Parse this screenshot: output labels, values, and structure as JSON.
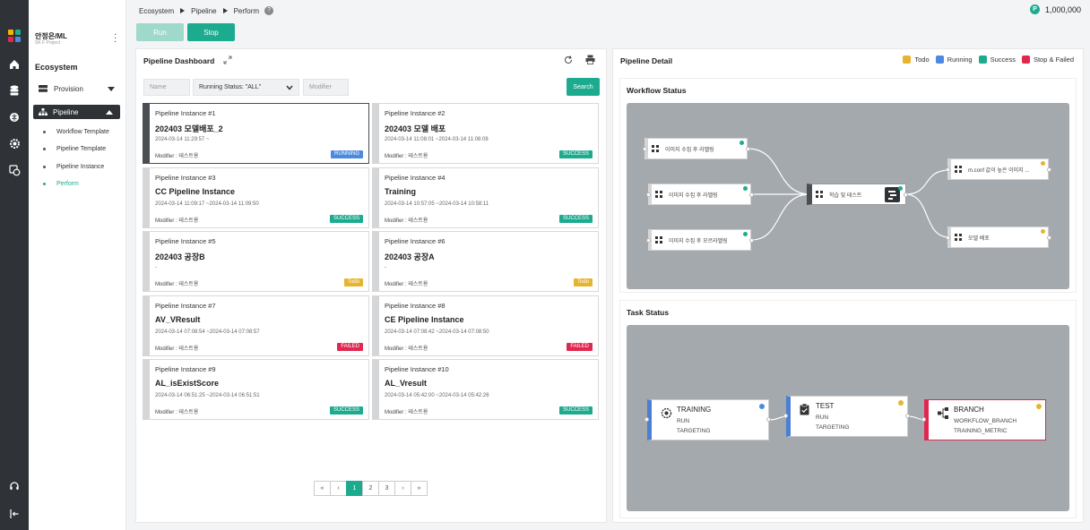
{
  "breadcrumb": [
    "Ecosystem",
    "Pipeline",
    "Perform"
  ],
  "help_glyph": "?",
  "points": {
    "icon": "P",
    "value": "1,000,000"
  },
  "user": {
    "name": "안정은/ML",
    "org": "SK F Project"
  },
  "sidebar": {
    "section": "Ecosystem",
    "provision": "Provision",
    "pipeline": "Pipeline",
    "sub": [
      "Workflow Template",
      "Pipeline Template",
      "Pipeline Instance",
      "Perform"
    ]
  },
  "buttons": {
    "run": "Run",
    "stop": "Stop",
    "search": "Search"
  },
  "dashboard": {
    "title": "Pipeline Dashboard",
    "filters": {
      "name_placeholder": "Name",
      "status": "Running Status: \"ALL\"",
      "modifier_placeholder": "Modifier"
    },
    "cards": [
      {
        "instance": "Pipeline Instance #1",
        "name": "202403 모델배포_2",
        "time": "2024-03-14 11:29:57 ~",
        "modifier": "Modifier : 테스트용",
        "status": "RUNNING"
      },
      {
        "instance": "Pipeline Instance #2",
        "name": "202403 모델 배포",
        "time": "2024-03-14 11:08:01 ~2024-03-14 11:08:08",
        "modifier": "Modifier : 테스트용",
        "status": "SUCCESS"
      },
      {
        "instance": "Pipeline Instance #3",
        "name": "CC Pipeline Instance",
        "time": "2024-03-14 11:09:17 ~2024-03-14 11:09:50",
        "modifier": "Modifier : 테스트용",
        "status": "SUCCESS"
      },
      {
        "instance": "Pipeline Instance #4",
        "name": "Training",
        "time": "2024-03-14 10:57:05 ~2024-03-14 10:58:11",
        "modifier": "Modifier : 테스트용",
        "status": "SUCCESS"
      },
      {
        "instance": "Pipeline Instance #5",
        "name": "202403 공장B",
        "time": "-",
        "modifier": "Modifier : 테스트용",
        "status": "Todo"
      },
      {
        "instance": "Pipeline Instance #6",
        "name": "202403 공장A",
        "time": "-",
        "modifier": "Modifier : 테스트용",
        "status": "Todo"
      },
      {
        "instance": "Pipeline Instance #7",
        "name": "AV_VResult",
        "time": "2024-03-14 07:08:54 ~2024-03-14 07:08:57",
        "modifier": "Modifier : 테스트용",
        "status": "FAILED"
      },
      {
        "instance": "Pipeline Instance #8",
        "name": "CE Pipeline Instance",
        "time": "2024-03-14 07:08:42 ~2024-03-14 07:08:50",
        "modifier": "Modifier : 테스트용",
        "status": "FAILED"
      },
      {
        "instance": "Pipeline Instance #9",
        "name": "AL_isExistScore",
        "time": "2024-03-14 06:51:25 ~2024-03-14 06:51:51",
        "modifier": "Modifier : 테스트용",
        "status": "SUCCESS"
      },
      {
        "instance": "Pipeline Instance #10",
        "name": "AL_Vresult",
        "time": "2024-03-14 05:42:00 ~2024-03-14 05:42:26",
        "modifier": "Modifier : 테스트용",
        "status": "SUCCESS"
      }
    ],
    "pagination": [
      "«",
      "‹",
      "1",
      "2",
      "3",
      "›",
      "»"
    ],
    "current_page": "1"
  },
  "detail": {
    "title": "Pipeline Detail",
    "legend": [
      {
        "label": "Todo",
        "color": "#e6b430"
      },
      {
        "label": "Running",
        "color": "#4c8ae0"
      },
      {
        "label": "Success",
        "color": "#1dab8f"
      },
      {
        "label": "Stop & Failed",
        "color": "#e0284f"
      }
    ],
    "workflow_title": "Workflow Status",
    "workflow_nodes": [
      "이미지 수집 후 라벨링",
      "이미지 수집 후 라벨링",
      "이미지 수집 후 모르라벨링",
      "학습 및 테스트",
      "m.conf 값이 높은 이미지 ...",
      "모델 배포"
    ],
    "task_title": "Task Status",
    "tasks": [
      {
        "name": "TRAINING",
        "line1": "RUN",
        "line2": "TARGETING"
      },
      {
        "name": "TEST",
        "line1": "RUN",
        "line2": "TARGETING"
      },
      {
        "name": "BRANCH",
        "line1": "WORKFLOW_BRANCH",
        "line2": "TRAINING_METRIC"
      }
    ]
  },
  "colors": {
    "accent": "#1dab8f",
    "running": "#4c8ae0",
    "success": "#1dab8f",
    "todo": "#e6b430",
    "failed": "#e0284f",
    "rail": "#2f3338"
  }
}
